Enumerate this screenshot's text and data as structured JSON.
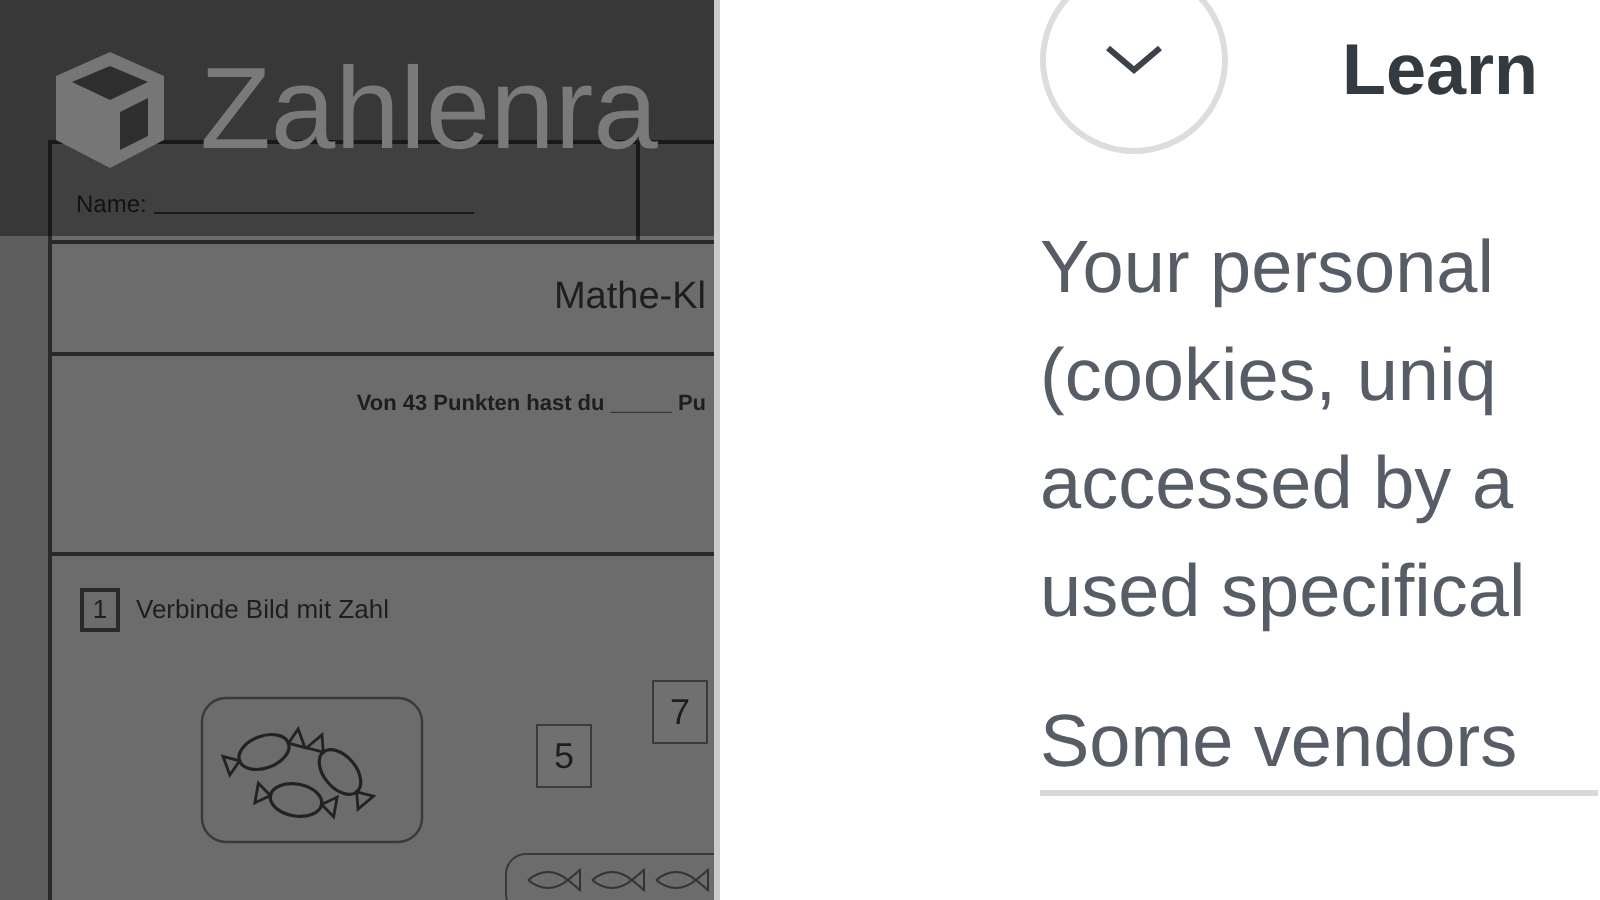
{
  "header": {
    "logo_text": "Zahlenra"
  },
  "worksheet": {
    "name_label": "Name:",
    "title": "Mathe-Kl",
    "score_line": "Von 43 Punkten hast du _____ Pu",
    "task": {
      "number": "1",
      "instruction": "Verbinde Bild mit Zahl"
    },
    "number_cards": [
      "5",
      "7"
    ]
  },
  "consent": {
    "heading": "Learn",
    "paragraph_lines": [
      "Your personal",
      "(cookies, uniq",
      "accessed by a",
      "used specifical"
    ],
    "link": "Some vendors"
  }
}
